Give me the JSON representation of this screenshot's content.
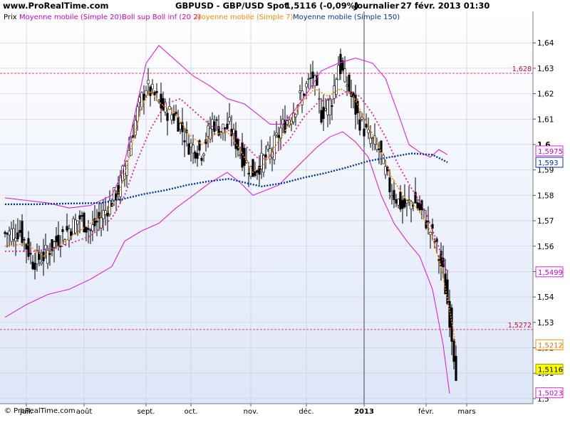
{
  "header": {
    "site": "www.ProRealTime.com",
    "title": "GBPUSD - GBP/USD Spot",
    "price_change": "1,5116 (-0,09%)",
    "timeframe": "Journalier",
    "datetime": "27 févr. 2013 01:30"
  },
  "legend": [
    {
      "label": "Prix",
      "color": "#000000"
    },
    {
      "label": "Moyenne mobile (Simple 20)",
      "color": "#cc00cc"
    },
    {
      "label": "Boll sup Boll inf (20 2)",
      "color": "#cc00cc"
    },
    {
      "label": "Moyenne mobile (Simple 7)",
      "color": "#ff8800"
    },
    {
      "label": "Moyenne mobile (Simple 150)",
      "color": "#0033aa"
    }
  ],
  "copyright": "© ProRealTime.com",
  "colors": {
    "background_top": "#ffffff",
    "background_bottom": "#dde6f8",
    "candles": "#000000",
    "ma20": "#e0209a",
    "bollinger": "#dd22dd",
    "ma7": "#ff8800",
    "ma150": "#0033aa",
    "hline": "#e8436a",
    "grid": "#c9cfdd"
  },
  "chart_data": {
    "type": "line",
    "title": "GBPUSD - GBP/USD Spot",
    "x_tick_labels": [
      "juil.",
      "août",
      "sept.",
      "oct.",
      "nov.",
      "déc.",
      "2013",
      "févr.",
      "mars"
    ],
    "y_ticks": [
      1.5,
      1.51,
      1.52,
      1.53,
      1.54,
      1.55,
      1.56,
      1.57,
      1.58,
      1.59,
      1.6,
      1.61,
      1.62,
      1.63,
      1.64
    ],
    "y_tick_labels": [
      "1,5",
      "1,51",
      "1,52",
      "1,53",
      "1,54",
      "1,55",
      "1,56",
      "1,57",
      "1,58",
      "1,59",
      "1,6",
      "1,61",
      "1,62",
      "1,63",
      "1,64"
    ],
    "ylim": [
      1.497,
      1.651
    ],
    "grid": true,
    "horizontal_lines": [
      {
        "value": 1.628,
        "label": "1,628"
      },
      {
        "value": 1.5272,
        "label": "1,5272"
      }
    ],
    "last_value_tags": [
      {
        "value": 1.5975,
        "label": "1,5975",
        "series": "Boll sup"
      },
      {
        "value": 1.593,
        "label": "1,593",
        "series": "Moyenne mobile (Simple 150)"
      },
      {
        "value": 1.5499,
        "label": "1,5499",
        "series": "Moyenne mobile (Simple 20)"
      },
      {
        "value": 1.5212,
        "label": "1,5212",
        "series": "Moyenne mobile (Simple 7)"
      },
      {
        "value": 1.5116,
        "label": "1,5116",
        "series": "Prix"
      },
      {
        "value": 1.5023,
        "label": "1,5023",
        "series": "Boll inf"
      }
    ],
    "series": [
      {
        "name": "Prix",
        "kind": "price",
        "points": [
          [
            0,
            1.565
          ],
          [
            7,
            1.566
          ],
          [
            13,
            1.554
          ],
          [
            18,
            1.556
          ],
          [
            24,
            1.562
          ],
          [
            29,
            1.566
          ],
          [
            35,
            1.571
          ],
          [
            40,
            1.566
          ],
          [
            47,
            1.574
          ],
          [
            53,
            1.582
          ],
          [
            58,
            1.598
          ],
          [
            62,
            1.613
          ],
          [
            66,
            1.623
          ],
          [
            70,
            1.619
          ],
          [
            74,
            1.614
          ],
          [
            80,
            1.611
          ],
          [
            86,
            1.6
          ],
          [
            92,
            1.597
          ],
          [
            97,
            1.609
          ],
          [
            101,
            1.606
          ],
          [
            105,
            1.607
          ],
          [
            111,
            1.595
          ],
          [
            116,
            1.589
          ],
          [
            120,
            1.593
          ],
          [
            125,
            1.598
          ],
          [
            129,
            1.606
          ],
          [
            134,
            1.612
          ],
          [
            139,
            1.62
          ],
          [
            144,
            1.627
          ],
          [
            148,
            1.612
          ],
          [
            153,
            1.618
          ],
          [
            156,
            1.632
          ],
          [
            160,
            1.624
          ],
          [
            165,
            1.611
          ],
          [
            170,
            1.603
          ],
          [
            175,
            1.598
          ],
          [
            180,
            1.583
          ],
          [
            186,
            1.575
          ],
          [
            191,
            1.578
          ],
          [
            196,
            1.572
          ],
          [
            201,
            1.562
          ],
          [
            205,
            1.549
          ],
          [
            208,
            1.532
          ],
          [
            211,
            1.511
          ]
        ]
      },
      {
        "name": "Moyenne mobile (Simple 7)",
        "kind": "ma7",
        "points": [
          [
            0,
            1.56
          ],
          [
            10,
            1.561
          ],
          [
            18,
            1.556
          ],
          [
            25,
            1.56
          ],
          [
            33,
            1.565
          ],
          [
            40,
            1.569
          ],
          [
            47,
            1.573
          ],
          [
            52,
            1.578
          ],
          [
            56,
            1.588
          ],
          [
            60,
            1.602
          ],
          [
            64,
            1.615
          ],
          [
            68,
            1.621
          ],
          [
            73,
            1.616
          ],
          [
            80,
            1.612
          ],
          [
            86,
            1.604
          ],
          [
            92,
            1.6
          ],
          [
            98,
            1.604
          ],
          [
            104,
            1.605
          ],
          [
            110,
            1.598
          ],
          [
            116,
            1.589
          ],
          [
            121,
            1.592
          ],
          [
            127,
            1.6
          ],
          [
            133,
            1.608
          ],
          [
            139,
            1.617
          ],
          [
            145,
            1.622
          ],
          [
            151,
            1.619
          ],
          [
            157,
            1.622
          ],
          [
            163,
            1.619
          ],
          [
            169,
            1.609
          ],
          [
            175,
            1.599
          ],
          [
            181,
            1.587
          ],
          [
            187,
            1.579
          ],
          [
            193,
            1.575
          ],
          [
            199,
            1.566
          ],
          [
            204,
            1.552
          ],
          [
            208,
            1.535
          ],
          [
            211,
            1.521
          ]
        ]
      },
      {
        "name": "Moyenne mobile (Simple 20)",
        "kind": "ma20",
        "points": [
          [
            0,
            1.558
          ],
          [
            14,
            1.558
          ],
          [
            27,
            1.56
          ],
          [
            40,
            1.564
          ],
          [
            50,
            1.571
          ],
          [
            56,
            1.58
          ],
          [
            62,
            1.594
          ],
          [
            68,
            1.606
          ],
          [
            75,
            1.616
          ],
          [
            82,
            1.618
          ],
          [
            90,
            1.612
          ],
          [
            97,
            1.607
          ],
          [
            104,
            1.606
          ],
          [
            112,
            1.6
          ],
          [
            119,
            1.594
          ],
          [
            126,
            1.596
          ],
          [
            133,
            1.602
          ],
          [
            140,
            1.611
          ],
          [
            147,
            1.617
          ],
          [
            154,
            1.618
          ],
          [
            160,
            1.621
          ],
          [
            166,
            1.619
          ],
          [
            172,
            1.612
          ],
          [
            178,
            1.603
          ],
          [
            184,
            1.592
          ],
          [
            190,
            1.583
          ],
          [
            196,
            1.575
          ],
          [
            202,
            1.562
          ],
          [
            207,
            1.549
          ]
        ]
      },
      {
        "name": "Boll sup",
        "kind": "bollinger",
        "points": [
          [
            0,
            1.579
          ],
          [
            10,
            1.578
          ],
          [
            20,
            1.577
          ],
          [
            30,
            1.575
          ],
          [
            40,
            1.576
          ],
          [
            50,
            1.58
          ],
          [
            55,
            1.589
          ],
          [
            60,
            1.609
          ],
          [
            66,
            1.632
          ],
          [
            72,
            1.639
          ],
          [
            80,
            1.633
          ],
          [
            88,
            1.627
          ],
          [
            96,
            1.623
          ],
          [
            104,
            1.618
          ],
          [
            112,
            1.616
          ],
          [
            118,
            1.612
          ],
          [
            124,
            1.608
          ],
          [
            130,
            1.608
          ],
          [
            136,
            1.614
          ],
          [
            142,
            1.621
          ],
          [
            148,
            1.629
          ],
          [
            156,
            1.632
          ],
          [
            164,
            1.634
          ],
          [
            172,
            1.632
          ],
          [
            178,
            1.626
          ],
          [
            184,
            1.612
          ],
          [
            189,
            1.6
          ],
          [
            194,
            1.597
          ],
          [
            199,
            1.595
          ],
          [
            203,
            1.598
          ],
          [
            207,
            1.596
          ]
        ]
      },
      {
        "name": "Boll inf",
        "kind": "bollinger",
        "points": [
          [
            0,
            1.532
          ],
          [
            10,
            1.537
          ],
          [
            20,
            1.541
          ],
          [
            30,
            1.543
          ],
          [
            40,
            1.547
          ],
          [
            50,
            1.552
          ],
          [
            56,
            1.562
          ],
          [
            64,
            1.566
          ],
          [
            72,
            1.569
          ],
          [
            80,
            1.575
          ],
          [
            88,
            1.58
          ],
          [
            96,
            1.585
          ],
          [
            104,
            1.589
          ],
          [
            110,
            1.585
          ],
          [
            116,
            1.58
          ],
          [
            122,
            1.582
          ],
          [
            128,
            1.584
          ],
          [
            134,
            1.589
          ],
          [
            140,
            1.594
          ],
          [
            146,
            1.599
          ],
          [
            152,
            1.603
          ],
          [
            158,
            1.605
          ],
          [
            164,
            1.601
          ],
          [
            170,
            1.595
          ],
          [
            176,
            1.58
          ],
          [
            182,
            1.569
          ],
          [
            188,
            1.562
          ],
          [
            194,
            1.556
          ],
          [
            200,
            1.543
          ],
          [
            205,
            1.521
          ],
          [
            208,
            1.502
          ]
        ]
      },
      {
        "name": "Moyenne mobile (Simple 150)",
        "kind": "ma150",
        "points": [
          [
            0,
            1.5765
          ],
          [
            15,
            1.5765
          ],
          [
            30,
            1.5768
          ],
          [
            45,
            1.577
          ],
          [
            55,
            1.5785
          ],
          [
            65,
            1.5805
          ],
          [
            75,
            1.582
          ],
          [
            85,
            1.584
          ],
          [
            95,
            1.5855
          ],
          [
            105,
            1.5865
          ],
          [
            113,
            1.5848
          ],
          [
            120,
            1.5835
          ],
          [
            130,
            1.5848
          ],
          [
            140,
            1.587
          ],
          [
            150,
            1.5888
          ],
          [
            160,
            1.591
          ],
          [
            170,
            1.5935
          ],
          [
            180,
            1.595
          ],
          [
            190,
            1.5965
          ],
          [
            200,
            1.596
          ],
          [
            207,
            1.593
          ]
        ]
      }
    ]
  }
}
